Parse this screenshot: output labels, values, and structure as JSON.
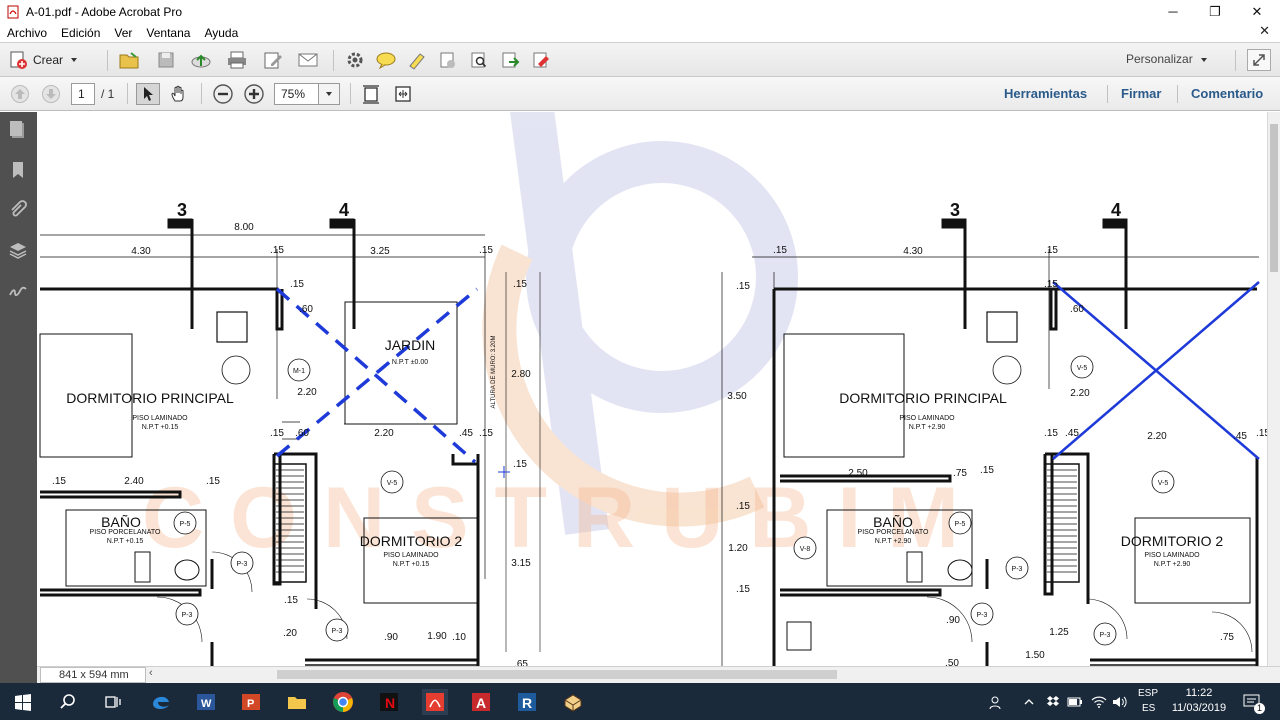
{
  "window": {
    "title": "A-01.pdf - Adobe Acrobat Pro"
  },
  "menu": {
    "items": [
      "Archivo",
      "Edición",
      "Ver",
      "Ventana",
      "Ayuda"
    ]
  },
  "toolbar": {
    "create_label": "Crear",
    "customize_label": "Personalizar"
  },
  "nav": {
    "page_current": "1",
    "page_total": "/ 1",
    "zoom": "75%",
    "links": [
      "Herramientas",
      "Firmar",
      "Comentario"
    ]
  },
  "status": {
    "page_size": "841 x 594 mm"
  },
  "plan": {
    "left": {
      "axis_labels": [
        "3",
        "4"
      ],
      "dims": [
        "8.00",
        "4.30",
        ".15",
        "3.25",
        ".15",
        ".15",
        ".60",
        "2.20",
        ".15",
        ".60",
        "2.20",
        ".45",
        ".15",
        "2.40",
        ".15",
        ".15",
        ".15",
        "2.80",
        ".15",
        "3.15",
        ".15",
        ".20",
        ".90",
        "1.90",
        ".10",
        ".65",
        ".15"
      ],
      "rooms": [
        {
          "name": "DORMITORIO PRINCIPAL",
          "floor": "PISO LAMINADO",
          "npt": "N.P.T +0.15"
        },
        {
          "name": "JARDIN",
          "floor": "",
          "npt": "N.P.T ±0.00"
        },
        {
          "name": "BAÑO",
          "floor": "PISO PORCELANATO",
          "npt": "N.P.T +0.15"
        },
        {
          "name": "DORMITORIO 2",
          "floor": "PISO LAMINADO",
          "npt": "N.P.T +0.15"
        }
      ],
      "tags": [
        "M-1",
        "V-5",
        "P-5",
        "P-3",
        "P-3",
        "P-3"
      ],
      "wall_note": "ALTURA DE MURO: 3.20M"
    },
    "right": {
      "axis_labels": [
        "3",
        "4"
      ],
      "dims": [
        "4.30",
        ".15",
        ".15",
        ".15",
        ".15",
        "3.50",
        ".60",
        "2.20",
        ".15",
        ".45",
        "2.20",
        ".45",
        ".15",
        "2.50",
        ".75",
        ".15",
        ".15",
        "1.20",
        ".15",
        ".90",
        "1.25",
        "1.50",
        ".50",
        ".75"
      ],
      "rooms": [
        {
          "name": "DORMITORIO PRINCIPAL",
          "floor": "PISO LAMINADO",
          "npt": "N.P.T +2.90"
        },
        {
          "name": "BAÑO",
          "floor": "PISO PORCELANATO",
          "npt": "N.P.T +2.90"
        },
        {
          "name": "DORMITORIO 2",
          "floor": "PISO LAMINADO",
          "npt": "N.P.T +2.90"
        }
      ],
      "tags": [
        "V-5",
        "V-5",
        "V-8",
        "P-5",
        "P-3",
        "P-3",
        "P-3"
      ]
    }
  },
  "watermark": {
    "text": "CONSTRUBIM",
    "color": "#f6b48a"
  },
  "taskbar": {
    "lang_top": "ESP",
    "lang_bottom": "ES",
    "time": "11:22",
    "date": "11/03/2019",
    "notif": "1"
  },
  "colors": {
    "annotation_blue": "#1e3ad8",
    "link_blue": "#2a5a8a",
    "taskbar": "#1b2a3a",
    "nav_panel": "#505050"
  }
}
